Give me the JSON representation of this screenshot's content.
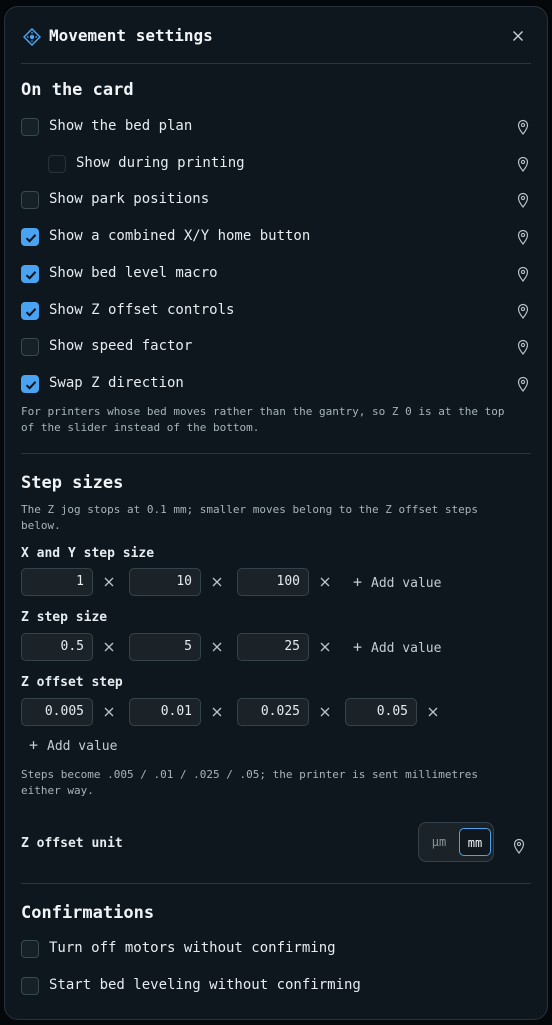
{
  "header": {
    "title": "Movement settings",
    "icon": "movement-crosshair-icon",
    "close_icon": "close-icon"
  },
  "colors": {
    "accent": "#4aa3f0",
    "panel": "#0e171d",
    "border": "#26323a"
  },
  "on_card": {
    "title": "On the card",
    "items": [
      {
        "label": "Show the bed plan",
        "checked": false
      },
      {
        "label": "Show during printing",
        "checked": false
      },
      {
        "label": "Show park positions",
        "checked": false
      },
      {
        "label": "Show a combined X/Y home button",
        "checked": true
      },
      {
        "label": "Show bed level macro",
        "checked": true
      },
      {
        "label": "Show Z offset controls",
        "checked": true
      },
      {
        "label": "Show speed factor",
        "checked": false
      },
      {
        "label": "Swap Z direction",
        "checked": true
      }
    ],
    "swap_description": "For printers whose bed moves rather than the gantry, so Z 0 is at the top of the slider instead of the bottom."
  },
  "step_sizes": {
    "title": "Step sizes",
    "description": "The Z jog stops at 0.1 mm; smaller moves belong to the Z offset steps below.",
    "xy": {
      "label": "X and Y step size",
      "values": [
        "1",
        "10",
        "100"
      ]
    },
    "z": {
      "label": "Z step size",
      "values": [
        "0.5",
        "5",
        "25"
      ]
    },
    "z_offset": {
      "label": "Z offset step",
      "values": [
        "0.005",
        "0.01",
        "0.025",
        "0.05"
      ]
    },
    "add_value_label": "Add value",
    "offset_note": "Steps become .005 / .01 / .025 / .05; the printer is sent millimetres either way.",
    "unit": {
      "label": "Z offset unit",
      "options": [
        "µm",
        "mm"
      ],
      "selected": "mm"
    }
  },
  "confirmations": {
    "title": "Confirmations",
    "items": [
      {
        "label": "Turn off motors without confirming",
        "checked": false
      },
      {
        "label": "Start bed leveling without confirming",
        "checked": false
      }
    ]
  }
}
